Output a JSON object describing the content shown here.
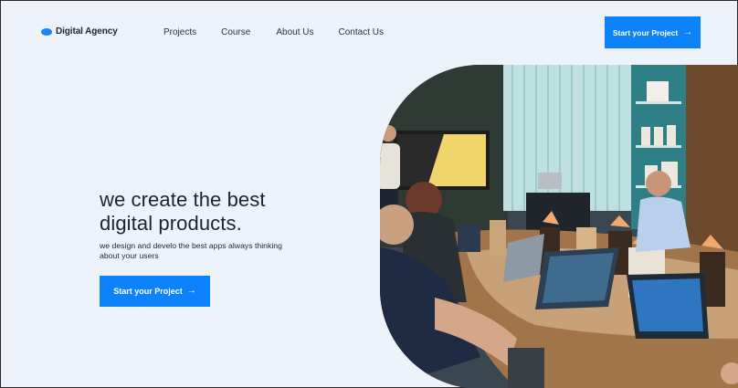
{
  "brand": {
    "name": "Digital Agency",
    "accent": "#0d83fb",
    "logo_icon": "oval-logo-icon"
  },
  "nav": {
    "items": [
      {
        "label": "Projects"
      },
      {
        "label": "Course"
      },
      {
        "label": "About Us"
      },
      {
        "label": "Contact Us"
      }
    ]
  },
  "header": {
    "cta_label": "Start your Project",
    "cta_icon": "arrow-right-icon"
  },
  "hero": {
    "title_line1": "we create the best",
    "title_line2": "digital products.",
    "subtitle": "we design and develo the best apps always thinking about your users",
    "cta_label": "Start your Project",
    "cta_icon": "arrow-right-icon",
    "image": "meeting-room-photo"
  }
}
